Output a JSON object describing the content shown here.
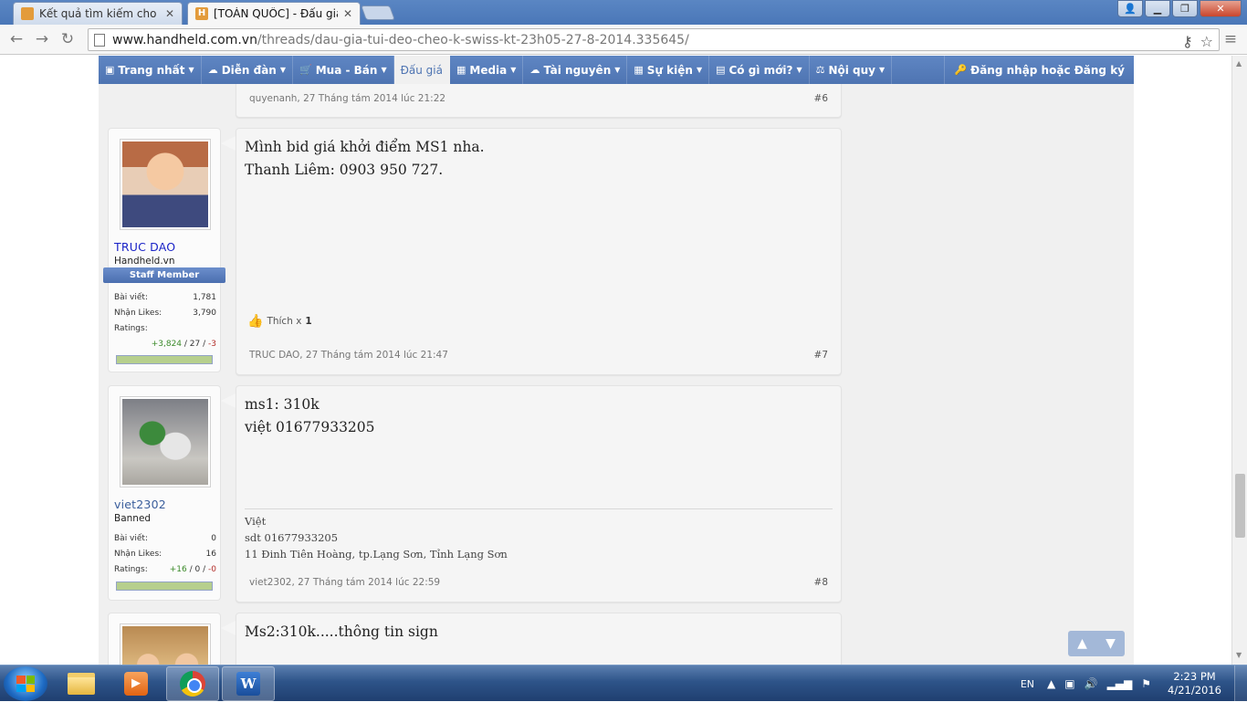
{
  "browser": {
    "tabs": [
      {
        "label": "Kết quả tìm kiếm cho từ k",
        "active": false
      },
      {
        "label": "[TOÀN QUỐC] - Đấu giá t",
        "active": true
      }
    ],
    "url_host": "www.handheld.com.vn",
    "url_path": "/threads/dau-gia-tui-deo-cheo-k-swiss-kt-23h05-27-8-2014.335645/"
  },
  "nav": {
    "items": [
      {
        "label": "Trang nhất",
        "icon": "home-icon",
        "glyph": "▣"
      },
      {
        "label": "Diễn đàn",
        "icon": "chat-icon",
        "glyph": "☁"
      },
      {
        "label": "Mua - Bán",
        "icon": "cart-icon",
        "glyph": "🛒"
      },
      {
        "label": "Đấu giá",
        "icon": "",
        "glyph": ""
      },
      {
        "label": "Media",
        "icon": "image-icon",
        "glyph": "▦"
      },
      {
        "label": "Tài nguyên",
        "icon": "cloud-download-icon",
        "glyph": "☁"
      },
      {
        "label": "Sự kiện",
        "icon": "calendar-icon",
        "glyph": "▦"
      },
      {
        "label": "Có gì mới?",
        "icon": "newspaper-icon",
        "glyph": "▤"
      },
      {
        "label": "Nội quy",
        "icon": "scales-icon",
        "glyph": "⚖"
      }
    ],
    "login": "Đăng nhập hoặc Đăng ký"
  },
  "posts": {
    "p6": {
      "author": "quyenanh",
      "date": "27 Tháng tám 2014 lúc 21:22",
      "num": "#6"
    },
    "p7": {
      "username": "TRUC DAO",
      "user_title": "Handheld.vn",
      "staff": "Staff Member",
      "stats": {
        "posts_label": "Bài viết:",
        "posts": "1,781",
        "likes_label": "Nhận Likes:",
        "likes": "3,790",
        "ratings_label": "Ratings:",
        "pos": "+3,824",
        "neutral": "27",
        "neg": "-3"
      },
      "lines": [
        "Mình bid giá khởi điểm MS1 nha.",
        "Thanh Liêm: 0903 950 727."
      ],
      "like_text": "Thích x",
      "like_count": "1",
      "author": "TRUC DAO",
      "date": "27 Tháng tám 2014 lúc 21:47",
      "num": "#7"
    },
    "p8": {
      "username": "viet2302",
      "user_title": "Banned",
      "stats": {
        "posts_label": "Bài viết:",
        "posts": "0",
        "likes_label": "Nhận Likes:",
        "likes": "16",
        "ratings_label": "Ratings:",
        "pos": "+16",
        "neutral": "0",
        "neg": "-0"
      },
      "lines": [
        "ms1: 310k",
        "việt 01677933205"
      ],
      "sig": [
        "Việt",
        "sdt 01677933205",
        "11 Đinh Tiên Hoàng, tp.Lạng Sơn, Tỉnh Lạng Sơn"
      ],
      "author": "viet2302",
      "date": "27 Tháng tám 2014 lúc 22:59",
      "num": "#8"
    },
    "p9": {
      "lines": [
        "Ms2:310k.....thông tin sign"
      ]
    }
  },
  "taskbar": {
    "lang": "EN",
    "time": "2:23 PM",
    "date": "4/21/2016"
  },
  "colors": {
    "nav": "#4e74b2",
    "staff_name": "#1a23c7",
    "member_name": "#3a5e9c"
  }
}
